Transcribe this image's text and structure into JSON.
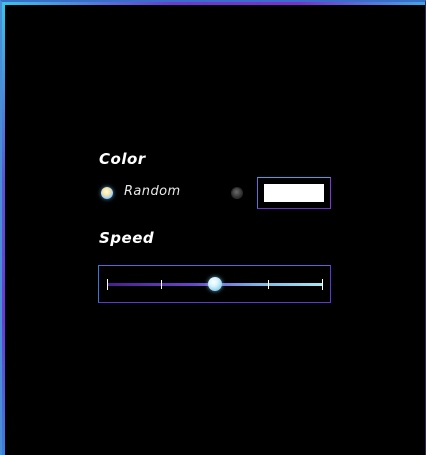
{
  "color": {
    "label": "Color",
    "random_label": "Random",
    "random_selected": true,
    "custom_selected": false,
    "custom_color": "#ffffff"
  },
  "speed": {
    "label": "Speed",
    "value_fraction": 0.5
  },
  "colors": {
    "background": "#000000",
    "text": "#ffffff",
    "accent_cyan": "#37c6e6",
    "accent_purple": "#6a3ad6"
  }
}
